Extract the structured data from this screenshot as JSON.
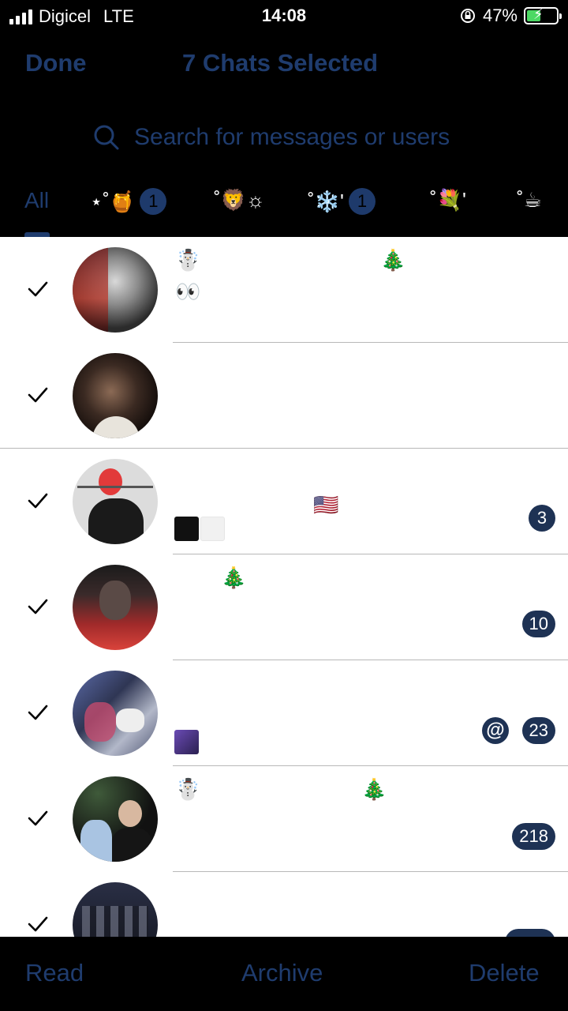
{
  "status_bar": {
    "carrier": "Digicel",
    "network": "LTE",
    "time": "14:08",
    "battery_percent": "47%",
    "battery_level": 0.47
  },
  "nav": {
    "done_label": "Done",
    "title": "7 Chats Selected"
  },
  "search": {
    "placeholder": "Search for messages or users",
    "icon": "search-icon"
  },
  "tabs": [
    {
      "label": "All",
      "active": true
    },
    {
      "label": "⋆˚🍯",
      "badge": "1"
    },
    {
      "label": "˚🦁☼"
    },
    {
      "label": "˚❄️'",
      "badge": "1"
    },
    {
      "label": "˚💐'"
    },
    {
      "label": "˚☕"
    }
  ],
  "chats": [
    {
      "selected": true,
      "line1_left": "☃️",
      "line1_right": "🎄",
      "line2": "👀",
      "badge": ""
    },
    {
      "selected": true,
      "badge": ""
    },
    {
      "selected": true,
      "flag": "🇺🇸",
      "badge": "3"
    },
    {
      "selected": true,
      "line1_left": "🎄",
      "badge": "10"
    },
    {
      "selected": true,
      "mention": "@",
      "badge": "23"
    },
    {
      "selected": true,
      "line1_left": "☃️",
      "line1_right": "🎄",
      "badge": "218"
    },
    {
      "selected": true,
      "badge": ""
    }
  ],
  "toolbar": {
    "read_label": "Read",
    "archive_label": "Archive",
    "delete_label": "Delete"
  },
  "colors": {
    "accent_dim": "#1f3c6e",
    "badge": "#1e3254",
    "battery_green": "#4cd964"
  }
}
